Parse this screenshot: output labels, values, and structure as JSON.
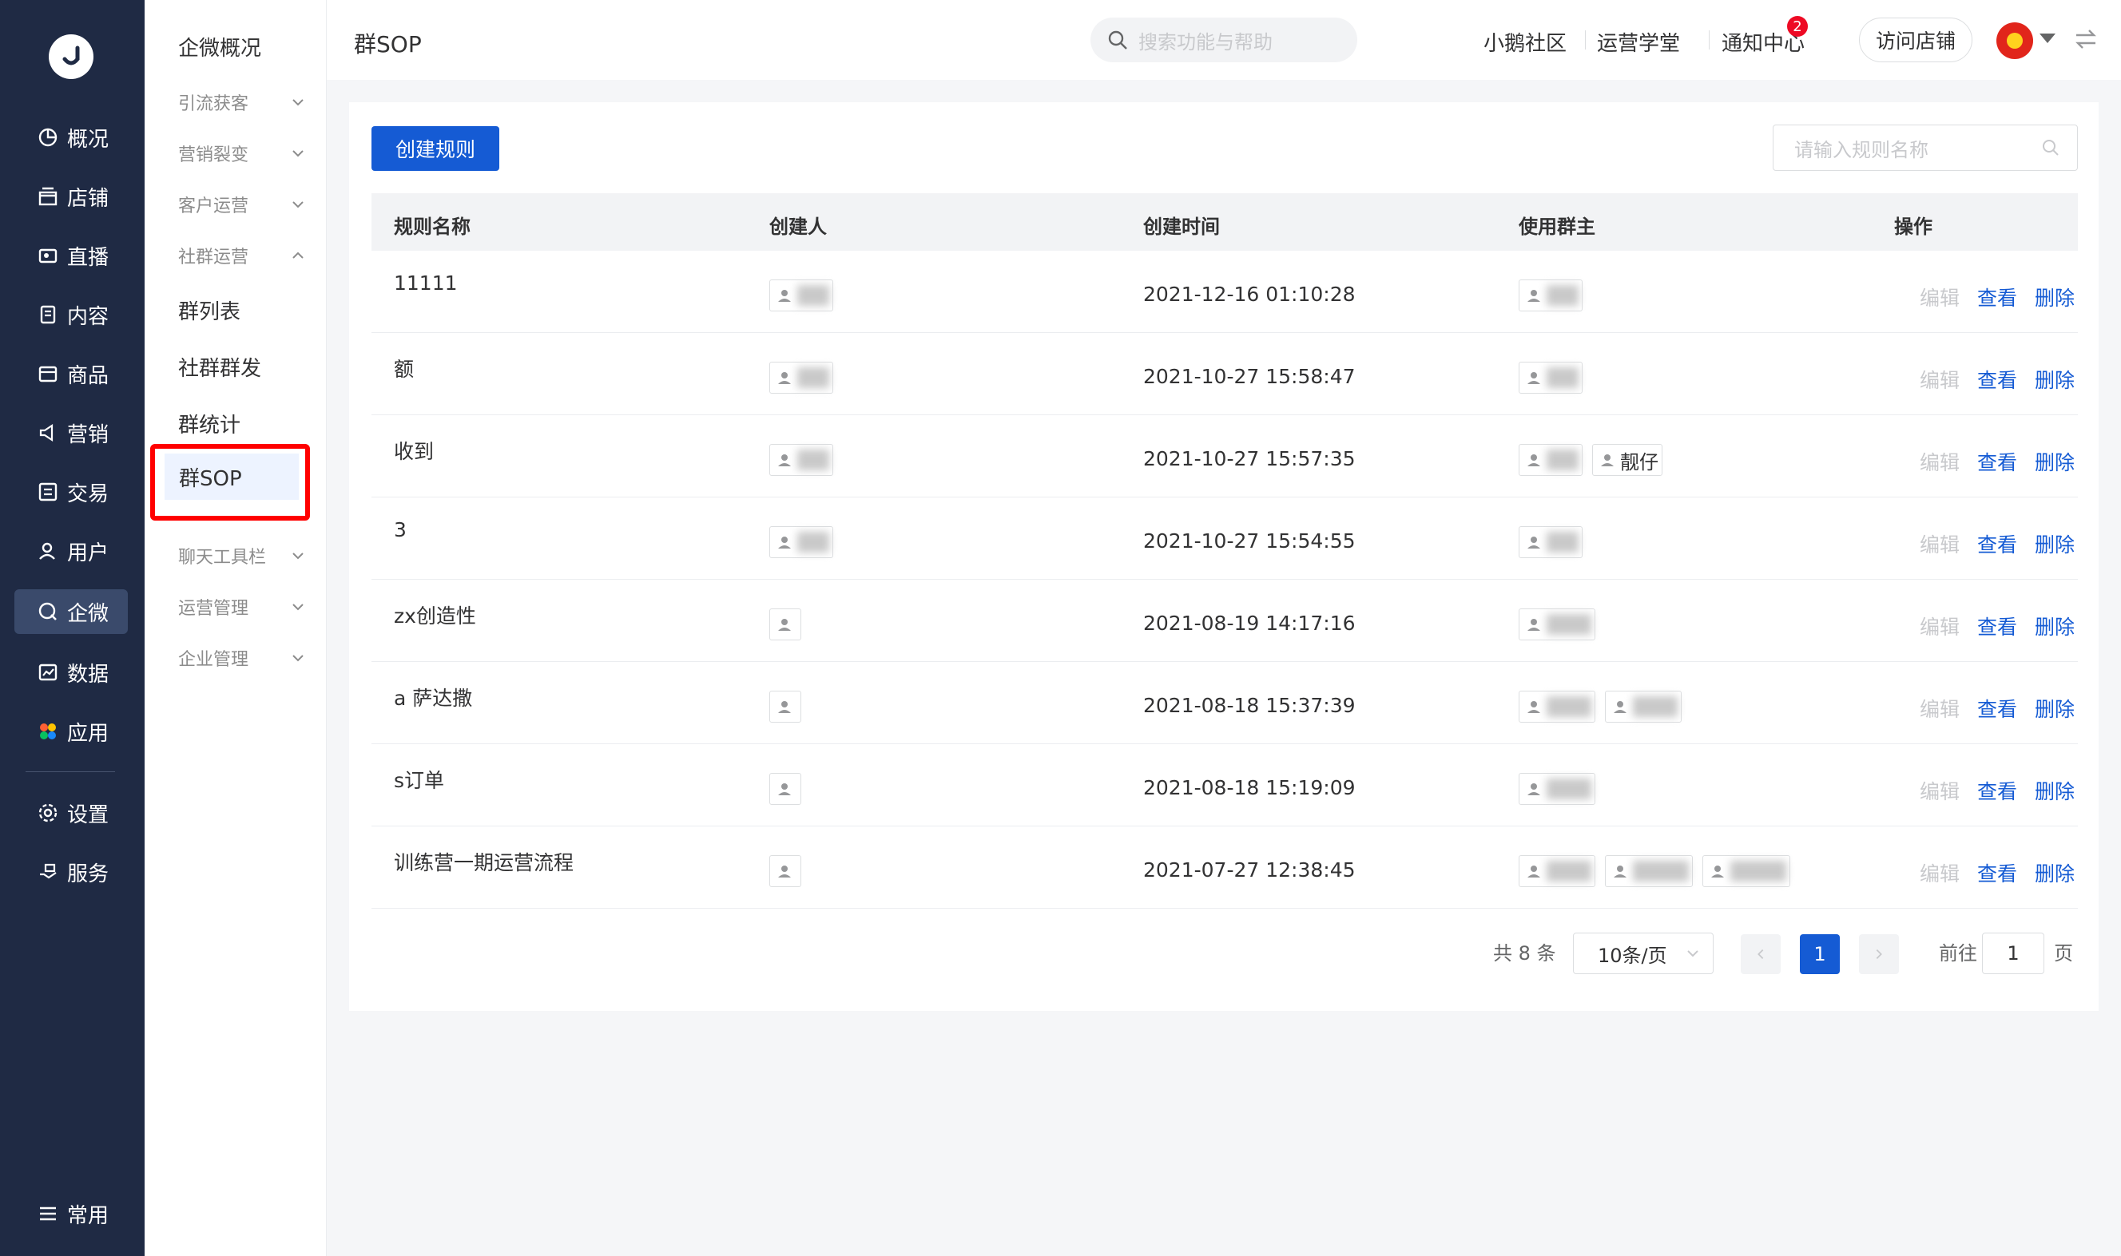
{
  "nav": {
    "items": [
      {
        "label": "概况",
        "icon": "pie-chart-icon"
      },
      {
        "label": "店铺",
        "icon": "store-icon"
      },
      {
        "label": "直播",
        "icon": "live-icon"
      },
      {
        "label": "内容",
        "icon": "document-icon"
      },
      {
        "label": "商品",
        "icon": "box-icon"
      },
      {
        "label": "营销",
        "icon": "megaphone-icon"
      },
      {
        "label": "交易",
        "icon": "trade-icon"
      },
      {
        "label": "用户",
        "icon": "user-icon"
      },
      {
        "label": "企微",
        "icon": "wecom-icon"
      },
      {
        "label": "数据",
        "icon": "chart-icon"
      },
      {
        "label": "应用",
        "icon": "apps-icon"
      },
      {
        "label": "设置",
        "icon": "gear-icon"
      },
      {
        "label": "服务",
        "icon": "service-icon"
      }
    ],
    "bottom_label": "常用",
    "active": "企微"
  },
  "submenu": {
    "title": "企微概况",
    "groups_top": [
      {
        "label": "引流获客"
      },
      {
        "label": "营销裂变"
      },
      {
        "label": "客户运营"
      },
      {
        "label": "社群运营"
      }
    ],
    "leaves": [
      {
        "label": "群列表"
      },
      {
        "label": "社群群发"
      },
      {
        "label": "群统计"
      }
    ],
    "active_label": "群SOP",
    "groups_bottom": [
      {
        "label": "聊天工具栏"
      },
      {
        "label": "运营管理"
      },
      {
        "label": "企业管理"
      }
    ]
  },
  "header": {
    "page_title": "群SOP",
    "search_placeholder": "搜索功能与帮助",
    "links": [
      "小鹅社区",
      "运营学堂",
      "通知中心"
    ],
    "notice_count": "2",
    "visit_store": "访问店铺"
  },
  "toolbar": {
    "create_button": "创建规则",
    "rule_search_placeholder": "请输入规则名称"
  },
  "table": {
    "columns": [
      "规则名称",
      "创建人",
      "创建时间",
      "使用群主",
      "操作"
    ],
    "ops": {
      "edit": "编辑",
      "view": "查看",
      "delete": "删除"
    },
    "rows": [
      {
        "name": "11111",
        "time": "2021-12-16 01:10:28",
        "owner_tag": ""
      },
      {
        "name": "额",
        "time": "2021-10-27 15:58:47",
        "owner_tag": ""
      },
      {
        "name": "收到",
        "time": "2021-10-27 15:57:35",
        "owner_tag": "靓仔"
      },
      {
        "name": "3",
        "time": "2021-10-27 15:54:55",
        "owner_tag": ""
      },
      {
        "name": "zx创造性",
        "time": "2021-08-19 14:17:16",
        "owner_tag": ""
      },
      {
        "name": "a 萨达撒",
        "time": "2021-08-18 15:37:39",
        "owner_tag": ""
      },
      {
        "name": "s订单",
        "time": "2021-08-18 15:19:09",
        "owner_tag": ""
      },
      {
        "name": "训练营一期运营流程",
        "time": "2021-07-27 12:38:45",
        "owner_tag": ""
      }
    ]
  },
  "pagination": {
    "total_text": "共 8 条",
    "page_size": "10条/页",
    "current_page": "1",
    "goto_prefix": "前往",
    "goto_value": "1",
    "goto_suffix": "页"
  },
  "colors": {
    "nav_bg": "#1f2a44",
    "primary": "#155bd4",
    "highlight": "#ff0000",
    "badge": "#ee0a24"
  }
}
